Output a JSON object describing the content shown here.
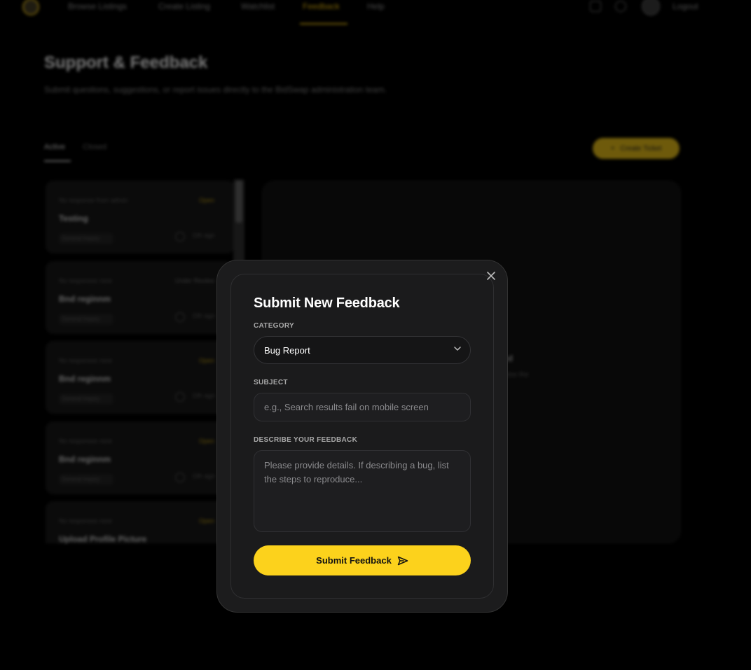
{
  "nav": {
    "links": [
      "Browse Listings",
      "Create Listing",
      "Watchlist",
      "Feedback",
      "Help"
    ],
    "active": "Feedback",
    "logout": "Logout"
  },
  "page": {
    "title": "Support & Feedback",
    "subtitle": "Submit questions, suggestions, or report issues directly to the BidSwap administration team."
  },
  "tabs": {
    "active": "Active",
    "closed": "Closed"
  },
  "create_ticket": {
    "label": "Create Ticket",
    "icon": "plus-icon"
  },
  "tickets": [
    {
      "meta": "No response from admin",
      "status": "Open",
      "title": "Testing",
      "category": "General Inquiry",
      "time": "19h ago"
    },
    {
      "meta": "No responses nore",
      "status": "Under Review",
      "title": "Bnd reginnm",
      "category": "General Inquiry",
      "time": "19h ago"
    },
    {
      "meta": "No responses nore",
      "status": "Open",
      "title": "Bnd reginnm",
      "category": "General Inquiry",
      "time": "19h ago"
    },
    {
      "meta": "No responses nore",
      "status": "Open",
      "title": "Bnd reginnm",
      "category": "General Inquiry",
      "time": "19h ago"
    },
    {
      "meta": "No responses nore",
      "status": "Open",
      "title": "Upload Profile Picture",
      "category": "General Inquiry",
      "time": "19h ago"
    }
  ],
  "detail": {
    "heading": "ed",
    "subtext": "view the"
  },
  "modal": {
    "title": "Submit New Feedback",
    "category_label": "CATEGORY",
    "category_value": "Bug Report",
    "subject_label": "SUBJECT",
    "subject_placeholder": "e.g., Search results fail on mobile screen",
    "subject_value": "",
    "description_label": "DESCRIBE YOUR FEEDBACK",
    "description_placeholder": "Please provide details. If describing a bug, list the steps to reproduce...",
    "description_value": "",
    "submit_label": "Submit Feedback",
    "submit_icon": "send-icon",
    "close_icon": "close-icon"
  },
  "colors": {
    "accent": "#fcd21c",
    "modal_bg": "#1c1c1d",
    "backdrop": "#000000"
  }
}
